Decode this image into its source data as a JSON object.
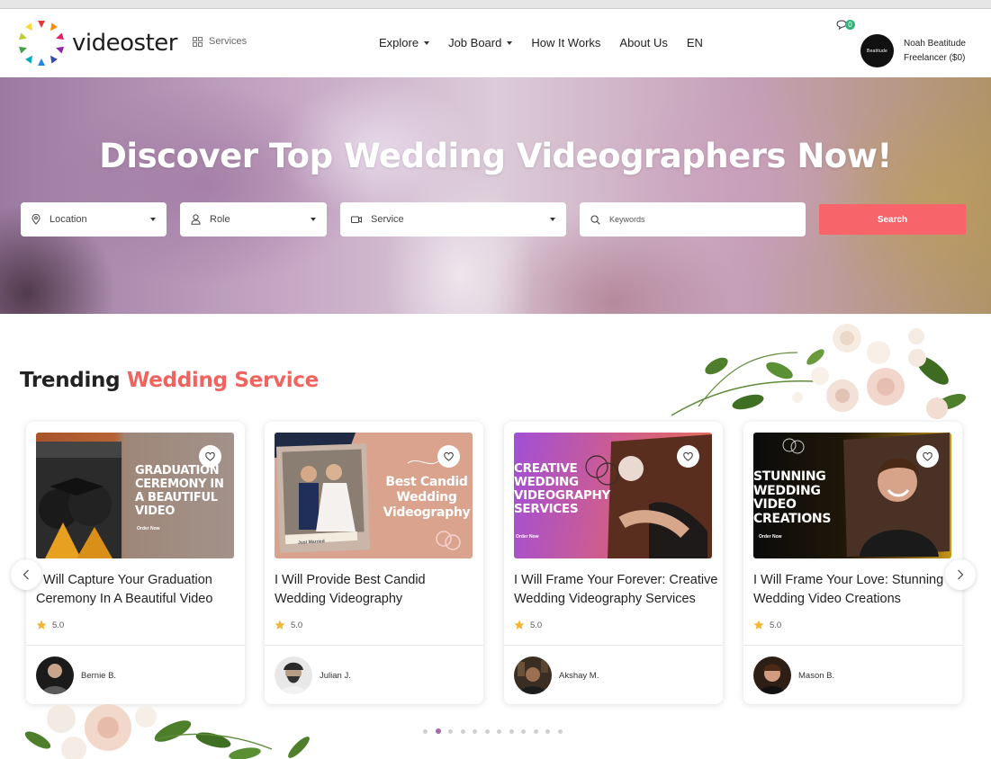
{
  "header": {
    "brand": "videoster",
    "services_label": "Services",
    "nav": [
      {
        "label": "Explore",
        "dropdown": true
      },
      {
        "label": "Job Board",
        "dropdown": true
      },
      {
        "label": "How It Works",
        "dropdown": false
      },
      {
        "label": "About Us",
        "dropdown": false
      },
      {
        "label": "EN",
        "dropdown": false
      }
    ],
    "chat_count": "0",
    "user": {
      "name": "Noah Beatitude",
      "role": "Freelancer ($0)",
      "avatar_text": "Beatitude"
    }
  },
  "hero": {
    "title": "Discover Top Wedding Videographers Now!",
    "filters": {
      "location": "Location",
      "role": "Role",
      "service": "Service"
    },
    "keywords_placeholder": "Keywords",
    "search_label": "Search"
  },
  "trending": {
    "title_prefix": "Trending",
    "title_accent": "Wedding Service",
    "cards": [
      {
        "image_text": "Graduation Ceremony In A Beautiful Video",
        "image_sub": "Order Now",
        "title": "I Will Capture Your Graduation Ceremony In A Beautiful Video",
        "rating": "5.0",
        "seller": "Bernie B."
      },
      {
        "image_text": "Best Candid Wedding Videography",
        "image_sub": "Just Married",
        "title": "I Will Provide Best Candid Wedding Videography",
        "rating": "5.0",
        "seller": "Julian J."
      },
      {
        "image_text": "Creative Wedding Videography Services",
        "image_sub": "Order Now",
        "title": "I Will Frame Your Forever: Creative Wedding Videography Services",
        "rating": "5.0",
        "seller": "Akshay M."
      },
      {
        "image_text": "Stunning Wedding Video Creations",
        "image_sub": "Order Now",
        "title": "I Will Frame Your Love: Stunning Wedding Video Creations",
        "rating": "5.0",
        "seller": "Mason B."
      }
    ],
    "page_count": 12,
    "active_page": 2
  },
  "colors": {
    "accent": "#f0645f",
    "search_button": "#f7656a",
    "star": "#f2b631",
    "active_dot": "#a56aa8"
  }
}
